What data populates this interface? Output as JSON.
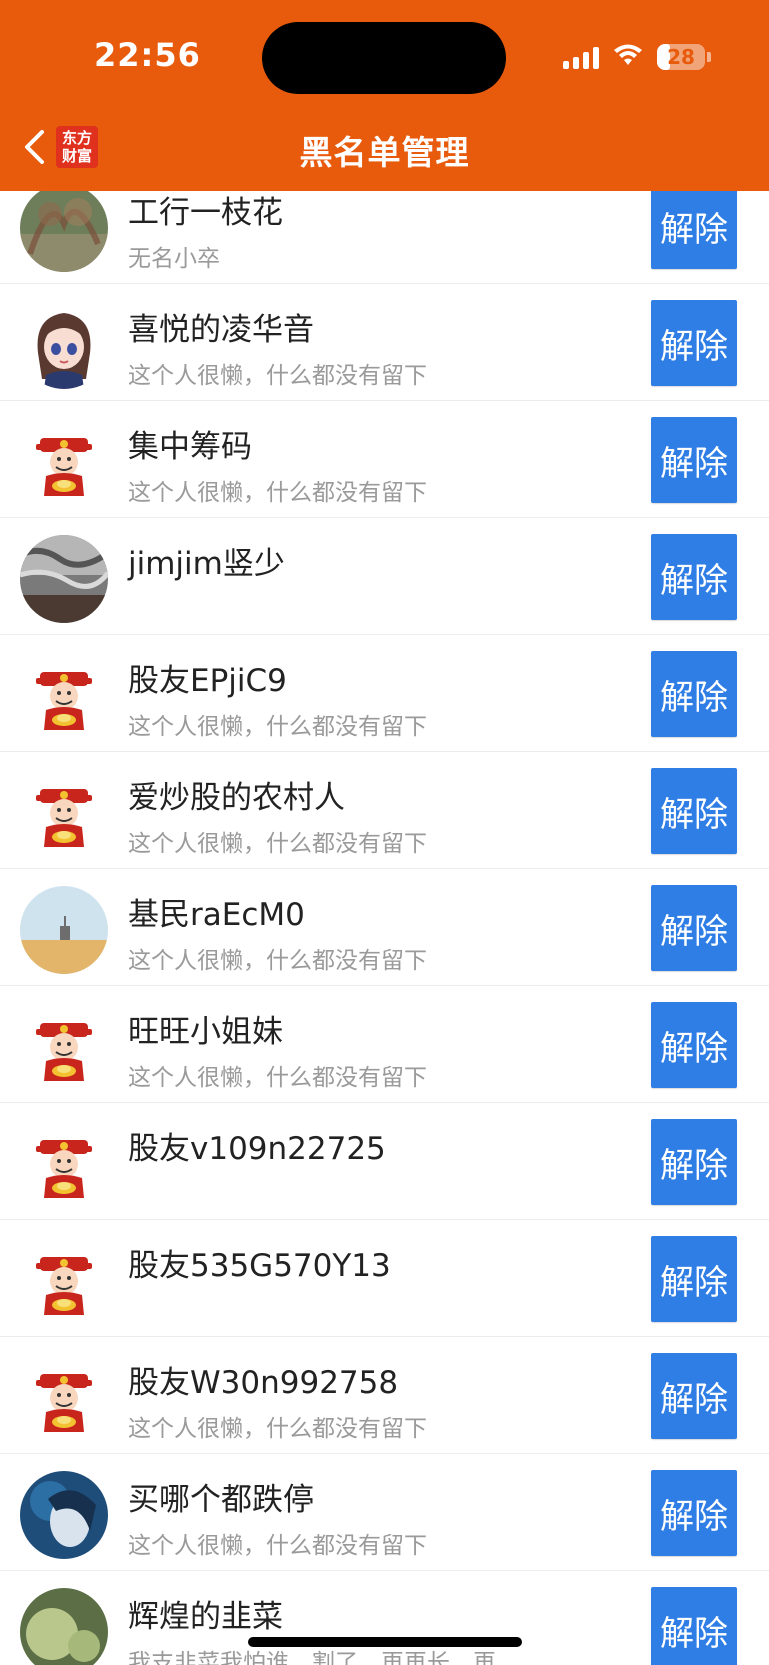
{
  "status_bar": {
    "time": "22:56",
    "battery": "28",
    "battery_level": 0.28
  },
  "header": {
    "title": "黑名单管理",
    "logo_line1": "东方",
    "logo_line2": "财富",
    "accent_color": "#E85A0C",
    "back_icon": "chevron-left-icon"
  },
  "unblock_label": "解除",
  "users": [
    {
      "name": "工行一枝花",
      "desc": "无名小卒",
      "avatar": "photo-plant"
    },
    {
      "name": "喜悦的凌华音",
      "desc": "这个人很懒，什么都没有留下",
      "avatar": "anime-girl"
    },
    {
      "name": "集中筹码",
      "desc": "这个人很懒，什么都没有留下",
      "avatar": "fortune-god"
    },
    {
      "name": "jimjim竖少",
      "desc": "",
      "avatar": "photo-texture"
    },
    {
      "name": "股友EPjiC9",
      "desc": "这个人很懒，什么都没有留下",
      "avatar": "fortune-god"
    },
    {
      "name": "爱炒股的农村人",
      "desc": "这个人很懒，什么都没有留下",
      "avatar": "fortune-god"
    },
    {
      "name": "基民raEcM0",
      "desc": "这个人很懒，什么都没有留下",
      "avatar": "photo-field"
    },
    {
      "name": "旺旺小姐妹",
      "desc": "这个人很懒，什么都没有留下",
      "avatar": "fortune-god"
    },
    {
      "name": "股友v109n22725",
      "desc": "",
      "avatar": "fortune-god"
    },
    {
      "name": "股友535G570Y13",
      "desc": "",
      "avatar": "fortune-god"
    },
    {
      "name": "股友W30n992758",
      "desc": "这个人很懒，什么都没有留下",
      "avatar": "fortune-god"
    },
    {
      "name": "买哪个都跌停",
      "desc": "这个人很懒，什么都没有留下",
      "avatar": "photo-portrait"
    },
    {
      "name": "辉煌的韭菜",
      "desc": "我支韭菜我怕谁，割了，再再长，再",
      "avatar": "photo-melon"
    }
  ],
  "button_color": "#2F7EE5"
}
